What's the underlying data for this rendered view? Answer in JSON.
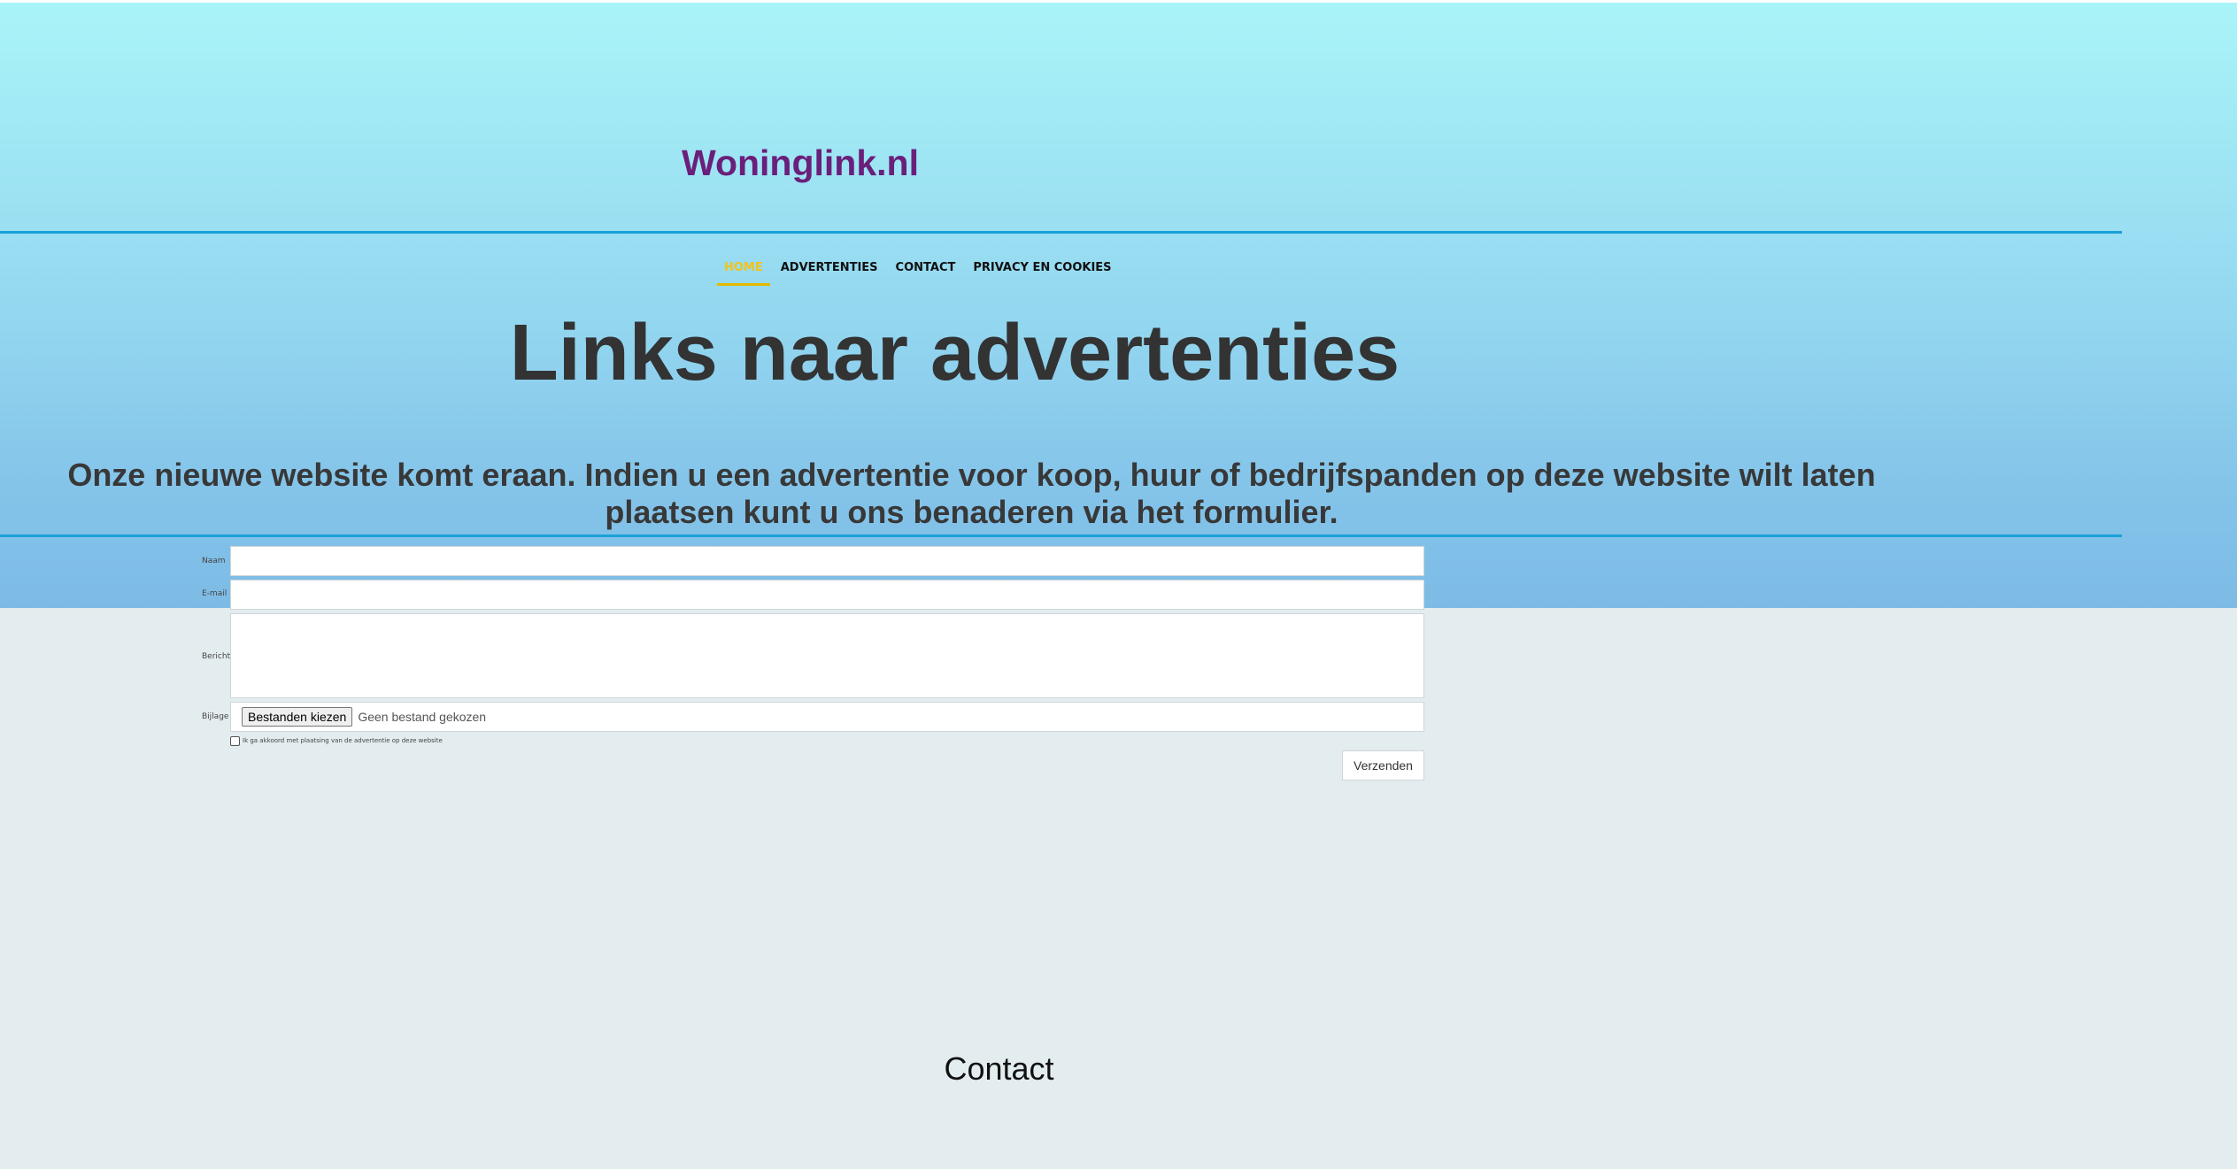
{
  "site": {
    "title": "Woninglink.nl"
  },
  "nav": {
    "items": [
      {
        "label": "HOME",
        "active": true
      },
      {
        "label": "ADVERTENTIES",
        "active": false
      },
      {
        "label": "CONTACT",
        "active": false
      },
      {
        "label": "PRIVACY EN COOKIES",
        "active": false
      }
    ]
  },
  "hero": {
    "headline": "Links naar advertenties",
    "intro": "Onze nieuwe website komt eraan. Indien u een advertentie voor koop, huur of bedrijfspanden op deze website wilt laten plaatsen kunt u ons benaderen via het formulier."
  },
  "form": {
    "naam_label": "Naam",
    "naam_value": "",
    "email_label": "E-mail",
    "email_value": "",
    "bericht_label": "Bericht",
    "bericht_value": "",
    "bijlage_label": "Bijlage",
    "file_button": "Bestanden kiezen",
    "file_status": "Geen bestand gekozen",
    "consent_label": "Ik ga akkoord met plaatsing van de advertentie op deze website",
    "consent_checked": false,
    "submit_label": "Verzenden"
  },
  "footer": {
    "title": "Contact"
  },
  "colors": {
    "brand": "#6a1f7a",
    "accent_rule": "#1aa0d8",
    "nav_active": "#f3c31a",
    "page_background": "#e3ecee"
  }
}
